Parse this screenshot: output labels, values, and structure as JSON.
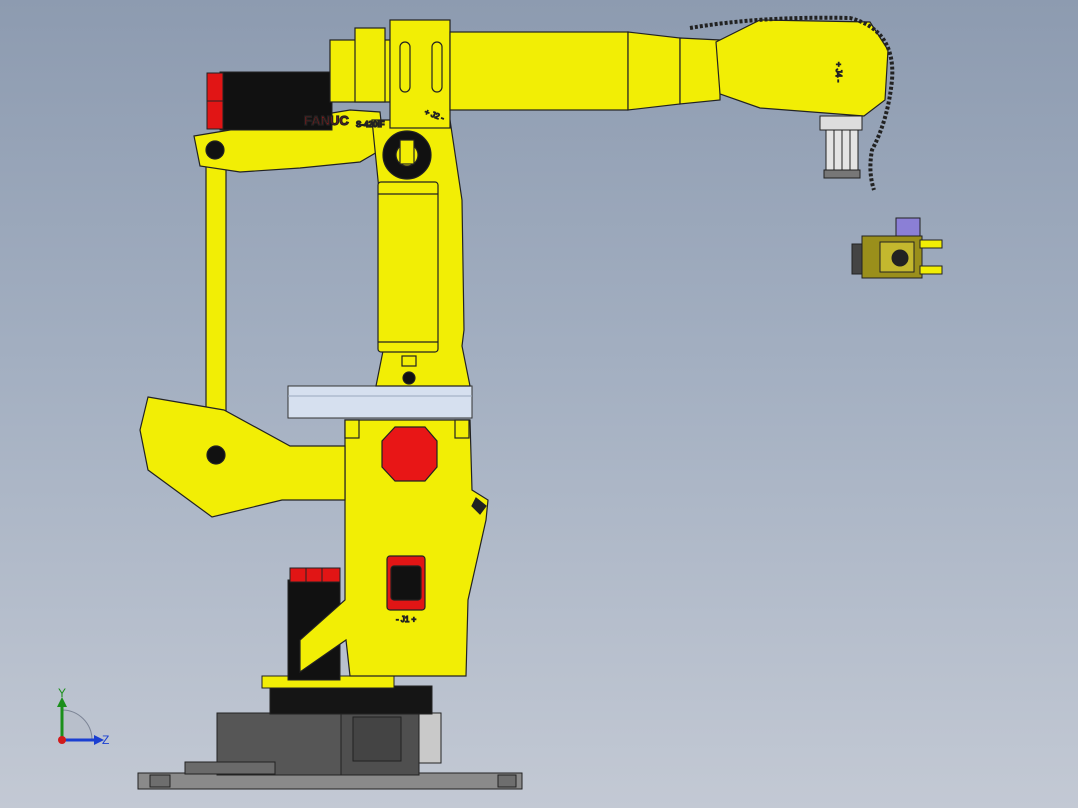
{
  "brand": "FANUC",
  "model": "S-420iF",
  "joints": {
    "j1": "- J1 +",
    "j2": "+ J2 -",
    "j4": "+ J4 -"
  },
  "triad": {
    "y": "Y",
    "z": "Z"
  },
  "colors": {
    "robot_yellow": "#f2ee05",
    "motor_black": "#111111",
    "motor_red": "#e11515",
    "base_gray": "#555555",
    "bracket_blue": "#d6e0ef",
    "label_red": "#8b1a1a"
  }
}
